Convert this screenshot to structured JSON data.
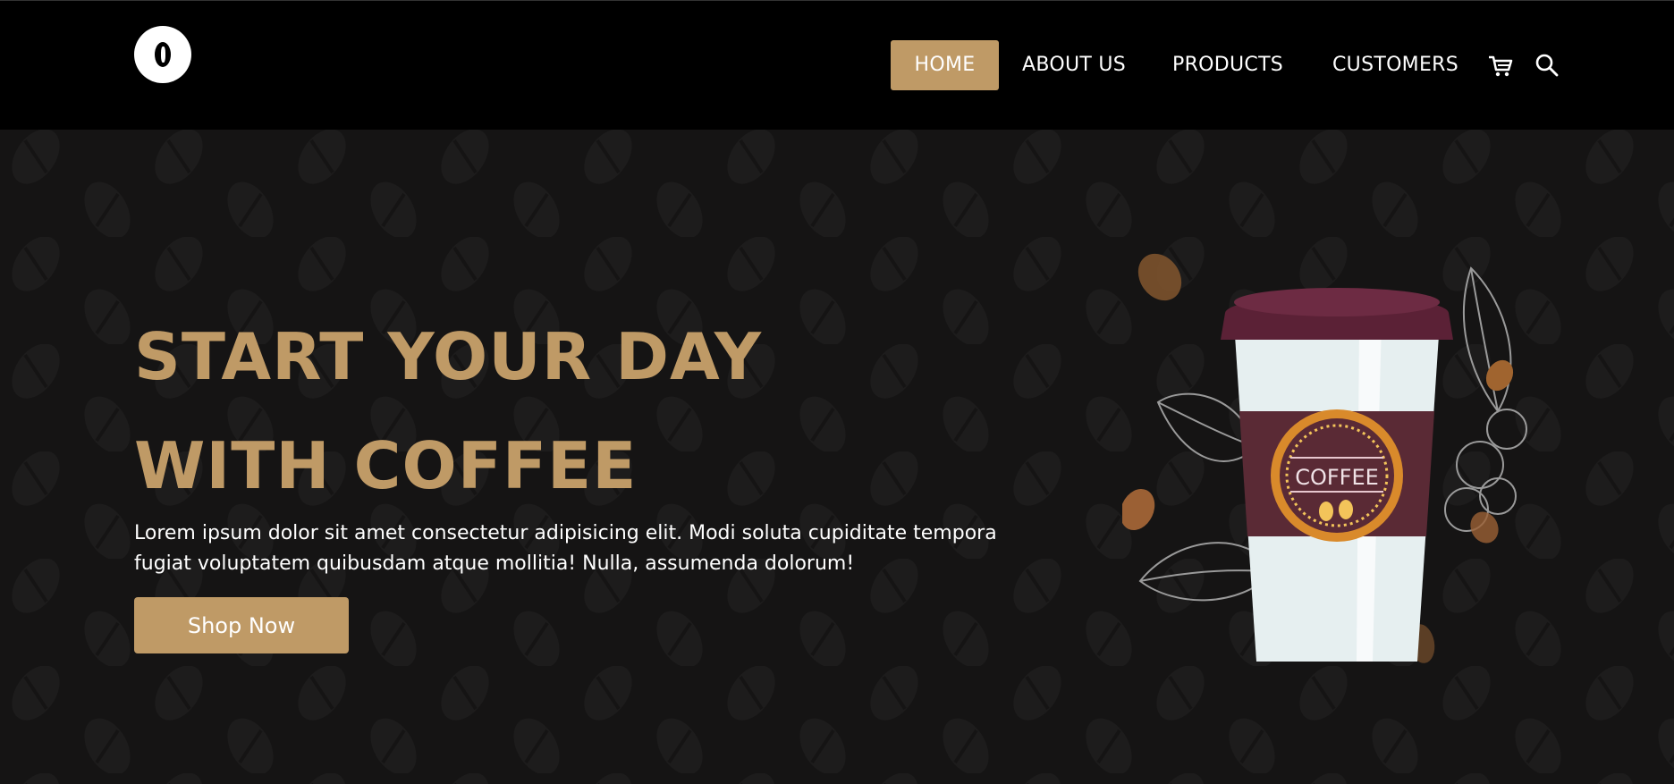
{
  "nav": {
    "items": [
      {
        "label": "HOME",
        "active": true
      },
      {
        "label": "ABOUT US",
        "active": false
      },
      {
        "label": "PRODUCTS",
        "active": false
      },
      {
        "label": "CUSTOMERS",
        "active": false
      }
    ],
    "icons": [
      "cart-icon",
      "search-icon"
    ]
  },
  "hero": {
    "headline_line1": "START YOUR DAY",
    "headline_line2": "WITH COFFEE",
    "description": "Lorem ipsum dolor sit amet consectetur adipisicing elit. Modi soluta cupiditate tempora fugiat voluptatem quibusdam atque mollitia! Nulla, assumenda dolorum!",
    "button_label": "Shop Now",
    "cup_label": "COFFEE"
  },
  "colors": {
    "accent": "#bf9a66",
    "header_bg": "#000000",
    "page_bg": "#151414",
    "cup_sleeve": "#5a2a35"
  }
}
